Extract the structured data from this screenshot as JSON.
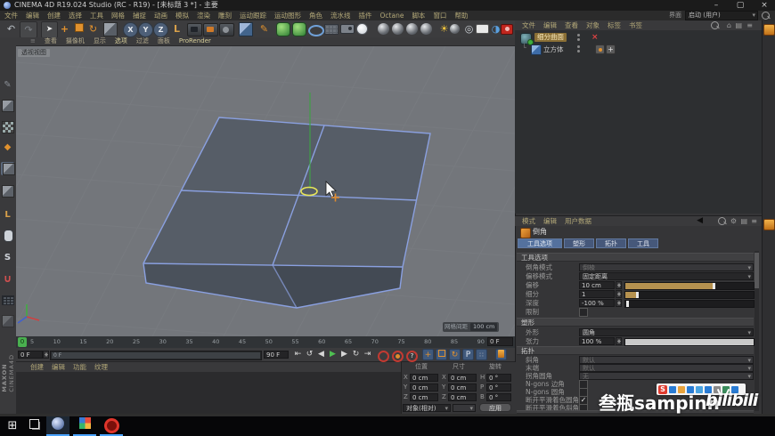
{
  "window": {
    "title": "CINEMA 4D R19.024 Studio (RC - R19) - [未标题 3 *] - 主要"
  },
  "menubar": {
    "items": [
      "文件",
      "编辑",
      "创建",
      "选择",
      "工具",
      "网格",
      "捕捉",
      "动画",
      "模拟",
      "渲染",
      "雕刻",
      "运动跟踪",
      "运动图形",
      "角色",
      "流水线",
      "插件",
      "Octane",
      "脚本",
      "窗口",
      "帮助"
    ],
    "interface_label": "界面",
    "layout_value": "启动 (用户)"
  },
  "toolbar": {
    "axis_x": "X",
    "axis_y": "Y",
    "axis_z": "Z",
    "coord_label": "L",
    "snap_s": "S"
  },
  "viewport": {
    "menu": [
      "查看",
      "摄像机",
      "显示",
      "选项",
      "过滤",
      "面板",
      "ProRender"
    ],
    "view_label": "透视视图",
    "grid_label": "网格间距",
    "grid_value": "100 cm"
  },
  "object_manager": {
    "menu": [
      "文件",
      "编辑",
      "查看",
      "对象",
      "标签",
      "书签"
    ],
    "objects": [
      {
        "name": "细分曲面"
      },
      {
        "name": "立方体"
      }
    ]
  },
  "attribute_manager": {
    "menu": [
      "模式",
      "编辑",
      "用户数据"
    ],
    "tool_name": "倒角",
    "tabs": [
      "工具选项",
      "塑形",
      "拓扑",
      "工具"
    ],
    "groups": {
      "options": "工具选项",
      "shaping": "塑形",
      "topology": "拓扑",
      "tool": "工具"
    },
    "options": {
      "bevel_mode": {
        "label": "倒角模式",
        "value": "倒棱"
      },
      "offset_mode": {
        "label": "偏移模式",
        "value": "固定距离"
      },
      "offset": {
        "label": "偏移",
        "value": "10 cm"
      },
      "subdivision": {
        "label": "细分",
        "value": "1"
      },
      "depth": {
        "label": "深度",
        "value": "-100 %"
      },
      "limit": {
        "label": "限制"
      }
    },
    "shaping": {
      "shape": {
        "label": "外形",
        "value": "圆角"
      },
      "tension": {
        "label": "张力",
        "value": "100 %"
      }
    },
    "topology": {
      "miter": {
        "label": "斜角",
        "value": "默认"
      },
      "ending": {
        "label": "末端",
        "value": "默认"
      },
      "corner": {
        "label": "拐角圆角",
        "value": "无"
      },
      "ngons_corner": {
        "label": "N-gons 边角"
      },
      "ngons_round": {
        "label": "N-gons 圆角"
      },
      "phong_round": {
        "label": "断开平滑着色圆角"
      },
      "phong_miter": {
        "label": "断开平滑着色斜角"
      }
    }
  },
  "timeline": {
    "playhead": "0",
    "ticks": [
      "5",
      "10",
      "15",
      "20",
      "25",
      "30",
      "35",
      "40",
      "45",
      "50",
      "55",
      "60",
      "65",
      "70",
      "75",
      "80",
      "85",
      "90"
    ],
    "current": "0 F",
    "start": "0 F",
    "end": "90 F",
    "range_label": "0 F"
  },
  "materials": {
    "menu": [
      "创建",
      "编辑",
      "功能",
      "纹理"
    ]
  },
  "coordinates": {
    "headers": [
      "位置",
      "尺寸",
      "旋转"
    ],
    "axis_pos": [
      "X",
      "Y",
      "Z"
    ],
    "axis_size": [
      "X",
      "Y",
      "Z"
    ],
    "axis_rot": [
      "H",
      "P",
      "B"
    ],
    "pos": {
      "x": "0 cm",
      "y": "0 cm",
      "z": "0 cm"
    },
    "size": {
      "x": "0 cm",
      "y": "0 cm",
      "z": "0 cm"
    },
    "rot": {
      "h": "0 °",
      "p": "0 °",
      "b": "0 °"
    },
    "mode": "对象(相对)",
    "apply": "应用"
  },
  "watermark": {
    "s_logo": "S",
    "channel": "叁瓶sampinn",
    "logo": "bilibili",
    "badge": "SAMPINN"
  },
  "branding": {
    "maxon": "MAXON",
    "cinema": "CINEMA4D"
  },
  "glyphs": {
    "undo": "↶",
    "redo": "↷",
    "move": "+",
    "rotate": "↻",
    "pen": "✎",
    "sun": "☀",
    "target": "◎",
    "half": "◑",
    "refresh": "↻",
    "points": "◆",
    "magnet": "∪",
    "go_start": "⇤",
    "go_end": "⇥",
    "prev": "◀",
    "next": "▶",
    "play": "▶",
    "loop_a": "↺",
    "loop_b": "↻",
    "home": "⌂",
    "list": "≡",
    "layers": "▤",
    "gear": "⚙",
    "check": "✓",
    "close_x": "×",
    "minimize": "–",
    "maximize": "▢",
    "start_grid": "⊞",
    "param_p": "P",
    "question": "?",
    "plus": "+",
    "menu_grid": "≡",
    "corner": "└"
  }
}
